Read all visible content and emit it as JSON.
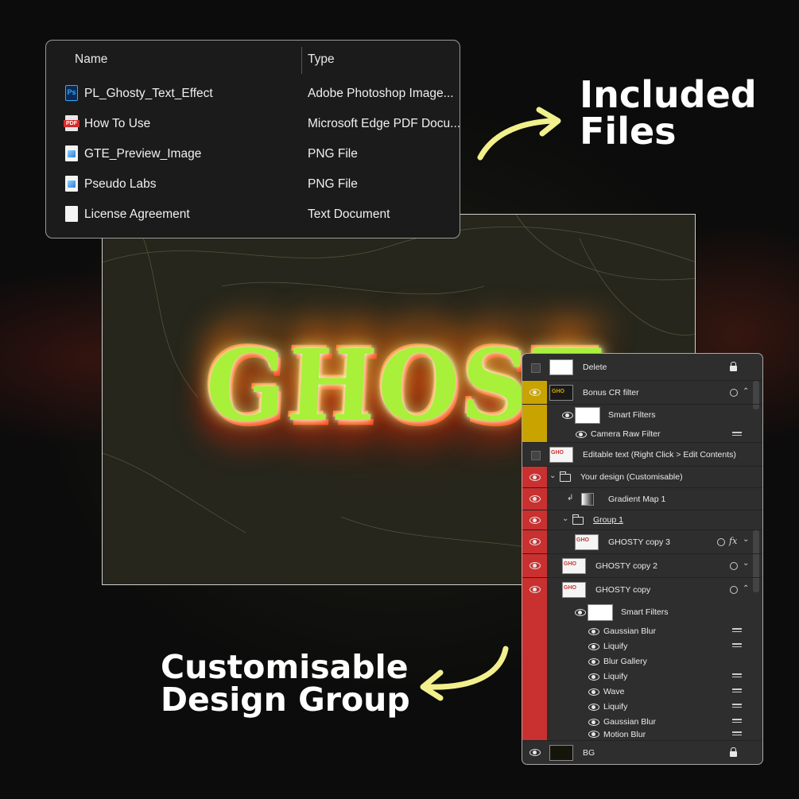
{
  "explorer": {
    "columns": {
      "name": "Name",
      "type": "Type"
    },
    "files": [
      {
        "name": "PL_Ghosty_Text_Effect",
        "type": "Adobe Photoshop Image...",
        "icon": "photoshop-file-icon"
      },
      {
        "name": "How To Use",
        "type": "Microsoft Edge PDF Docu...",
        "icon": "pdf-file-icon"
      },
      {
        "name": "GTE_Preview_Image",
        "type": "PNG File",
        "icon": "png-file-icon"
      },
      {
        "name": "Pseudo Labs",
        "type": "PNG File",
        "icon": "png-file-icon"
      },
      {
        "name": "License Agreement",
        "type": "Text Document",
        "icon": "text-file-icon"
      }
    ]
  },
  "preview": {
    "text": "GHOST"
  },
  "callouts": {
    "included_files": {
      "line1": "Included",
      "line2": "Files"
    },
    "design_group": {
      "line1": "Customisable",
      "line2": "Design Group"
    },
    "arrow_color": "#f2f08c"
  },
  "layers": {
    "rows": [
      {
        "name": "Delete"
      },
      {
        "name": "Bonus CR filter"
      },
      {
        "name": "Smart Filters"
      },
      {
        "name": "Camera Raw Filter"
      },
      {
        "name": "Editable text (Right Click > Edit Contents)"
      },
      {
        "name": "Your design (Customisable)"
      },
      {
        "name": "Gradient Map 1"
      },
      {
        "name": "Group 1"
      },
      {
        "name": "GHOSTY copy 3"
      },
      {
        "name": "GHOSTY copy 2"
      },
      {
        "name": "GHOSTY copy"
      },
      {
        "name": "Smart Filters"
      },
      {
        "name": "Gaussian Blur"
      },
      {
        "name": "Liquify"
      },
      {
        "name": "Blur Gallery"
      },
      {
        "name": "Liquify"
      },
      {
        "name": "Wave"
      },
      {
        "name": "Liquify"
      },
      {
        "name": "Gaussian Blur"
      },
      {
        "name": "Motion Blur"
      },
      {
        "name": "BG"
      }
    ],
    "fx_label": "fx",
    "strip_colors": {
      "yellow": "#c9a300",
      "red": "#c93030"
    }
  }
}
